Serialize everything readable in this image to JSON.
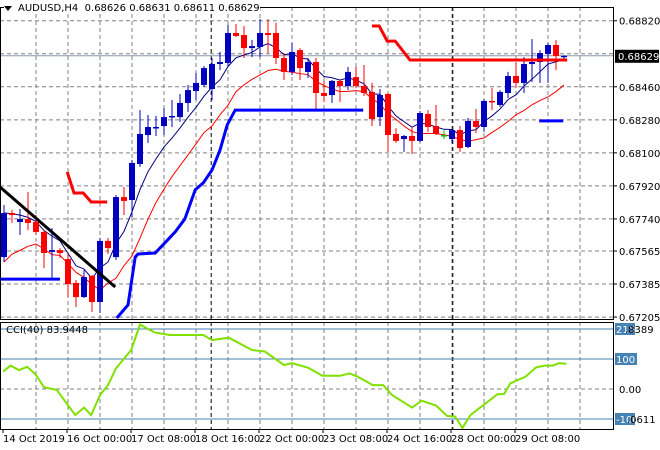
{
  "header": {
    "symbol": "AUDUSD,H4",
    "open": "0.68626",
    "high": "0.68631",
    "low": "0.68611",
    "close": "0.68629"
  },
  "cci_label": {
    "name": "CCI(40)",
    "value": "83.9448"
  },
  "colors": {
    "bull": "#0000c0",
    "bear": "#ff0000",
    "doji": "#00c000",
    "ma_fast": "#000080",
    "ma_slow": "#ff0000",
    "stop_blue": "#0000ff",
    "stop_red": "#ff0000",
    "trend": "#000000",
    "cci": "#80e000",
    "level": "#4682b4",
    "grid": "#808080"
  },
  "chart_data": [
    {
      "type": "candlestick",
      "title": "AUDUSD,H4",
      "ylim": [
        0.67205,
        0.6884
      ],
      "y_ticks": [
        "0.68820",
        "0.68460",
        "0.68280",
        "0.68100",
        "0.67920",
        "0.67740",
        "0.67565",
        "0.67385",
        "0.67205"
      ],
      "current_price": "0.68629",
      "x_labels": [
        {
          "index": 0,
          "label": "14 Oct 2019"
        },
        {
          "index": 8,
          "label": "16 Oct 00:00"
        },
        {
          "index": 16,
          "label": "17 Oct 08:00"
        },
        {
          "index": 24,
          "label": "18 Oct 16:00"
        },
        {
          "index": 32,
          "label": "22 Oct 00:00"
        },
        {
          "index": 40,
          "label": "23 Oct 08:00"
        },
        {
          "index": 48,
          "label": "24 Oct 16:00"
        },
        {
          "index": 56,
          "label": "28 Oct 00:00"
        },
        {
          "index": 64,
          "label": "29 Oct 08:00"
        }
      ],
      "period_separators": [
        25.9,
        56.1
      ],
      "ohlc": [
        [
          0.67532,
          0.67816,
          0.67505,
          0.67772
        ],
        [
          0.67772,
          0.67788,
          0.67718,
          0.67761
        ],
        [
          0.67723,
          0.67794,
          0.67652,
          0.67739
        ],
        [
          0.67739,
          0.67887,
          0.67679,
          0.67718
        ],
        [
          0.67723,
          0.67761,
          0.67652,
          0.67669
        ],
        [
          0.67669,
          0.67679,
          0.67472,
          0.67554
        ],
        [
          0.6756,
          0.6769,
          0.67418,
          0.6757
        ],
        [
          0.6757,
          0.67581,
          0.67527,
          0.67554
        ],
        [
          0.67521,
          0.67549,
          0.67314,
          0.67385
        ],
        [
          0.67391,
          0.67407,
          0.6726,
          0.67314
        ],
        [
          0.67314,
          0.67461,
          0.67309,
          0.67423
        ],
        [
          0.67429,
          0.67434,
          0.67233,
          0.67287
        ],
        [
          0.67287,
          0.67636,
          0.67227,
          0.6762
        ],
        [
          0.6762,
          0.67636,
          0.67549,
          0.67581
        ],
        [
          0.67532,
          0.6787,
          0.67516,
          0.67859
        ],
        [
          0.67859,
          0.67914,
          0.67761,
          0.67838
        ],
        [
          0.67843,
          0.68061,
          0.6775,
          0.68045
        ],
        [
          0.68039,
          0.68333,
          0.68023,
          0.68203
        ],
        [
          0.68197,
          0.68306,
          0.68154,
          0.68241
        ],
        [
          0.68235,
          0.68301,
          0.68192,
          0.68241
        ],
        [
          0.68246,
          0.68344,
          0.68197,
          0.68295
        ],
        [
          0.68295,
          0.68388,
          0.68241,
          0.68301
        ],
        [
          0.68295,
          0.68421,
          0.68268,
          0.68372
        ],
        [
          0.68372,
          0.6847,
          0.68323,
          0.68442
        ],
        [
          0.68437,
          0.68535,
          0.68388,
          0.68481
        ],
        [
          0.6847,
          0.68573,
          0.68459,
          0.68562
        ],
        [
          0.68448,
          0.68617,
          0.68388,
          0.68584
        ],
        [
          0.68584,
          0.6865,
          0.68551,
          0.68595
        ],
        [
          0.6859,
          0.68797,
          0.68568,
          0.68753
        ],
        [
          0.68753,
          0.68802,
          0.68731,
          0.68737
        ],
        [
          0.68742,
          0.68791,
          0.68617,
          0.68671
        ],
        [
          0.68671,
          0.68715,
          0.68622,
          0.68682
        ],
        [
          0.68677,
          0.68829,
          0.68622,
          0.68753
        ],
        [
          0.68753,
          0.68829,
          0.68644,
          0.68742
        ],
        [
          0.68753,
          0.68808,
          0.68584,
          0.68617
        ],
        [
          0.68617,
          0.68644,
          0.68497,
          0.68541
        ],
        [
          0.68541,
          0.68699,
          0.68524,
          0.6865
        ],
        [
          0.6866,
          0.68671,
          0.68497,
          0.68562
        ],
        [
          0.68541,
          0.68617,
          0.68508,
          0.68595
        ],
        [
          0.68595,
          0.68617,
          0.68339,
          0.68426
        ],
        [
          0.68426,
          0.68492,
          0.68377,
          0.6841
        ],
        [
          0.68415,
          0.68497,
          0.68372,
          0.68492
        ],
        [
          0.68492,
          0.68502,
          0.68377,
          0.68464
        ],
        [
          0.68464,
          0.68568,
          0.68442,
          0.68541
        ],
        [
          0.68513,
          0.68568,
          0.68453,
          0.68464
        ],
        [
          0.68464,
          0.68579,
          0.6841,
          0.68426
        ],
        [
          0.68432,
          0.68481,
          0.68246,
          0.68284
        ],
        [
          0.68295,
          0.68448,
          0.68246,
          0.68415
        ],
        [
          0.68421,
          0.68426,
          0.68105,
          0.68197
        ],
        [
          0.68203,
          0.68235,
          0.68154,
          0.68165
        ],
        [
          0.68175,
          0.68197,
          0.68105,
          0.68192
        ],
        [
          0.68192,
          0.68241,
          0.68094,
          0.68165
        ],
        [
          0.68165,
          0.68328,
          0.68159,
          0.68317
        ],
        [
          0.68312,
          0.68333,
          0.68214,
          0.68241
        ],
        [
          0.68246,
          0.68361,
          0.68197,
          0.68203
        ],
        [
          0.68197,
          0.68224,
          0.68175,
          0.68197
        ],
        [
          0.68175,
          0.6823,
          0.68154,
          0.68224
        ],
        [
          0.68224,
          0.68246,
          0.68105,
          0.68126
        ],
        [
          0.68132,
          0.6829,
          0.68126,
          0.68274
        ],
        [
          0.68274,
          0.68339,
          0.68208,
          0.68241
        ],
        [
          0.68241,
          0.68393,
          0.68214,
          0.68383
        ],
        [
          0.68383,
          0.68453,
          0.68333,
          0.68377
        ],
        [
          0.68361,
          0.68442,
          0.6835,
          0.68432
        ],
        [
          0.68426,
          0.68541,
          0.68399,
          0.68519
        ],
        [
          0.68519,
          0.68595,
          0.68453,
          0.68481
        ],
        [
          0.68481,
          0.68622,
          0.68426,
          0.68584
        ],
        [
          0.68584,
          0.6872,
          0.68486,
          0.68595
        ],
        [
          0.68595,
          0.6866,
          0.68481,
          0.68644
        ],
        [
          0.68639,
          0.68699,
          0.68481,
          0.68688
        ],
        [
          0.68688,
          0.68715,
          0.68551,
          0.68628
        ],
        [
          0.68626,
          0.68631,
          0.68611,
          0.68629
        ]
      ],
      "overlays": {
        "stop_blue": [
          [
            [
              -0.5,
              0.67412
            ],
            [
              7,
              0.67412
            ]
          ],
          [
            [
              14.1,
              0.672
            ],
            [
              15.5,
              0.67271
            ],
            [
              16.4,
              0.67532
            ],
            [
              16.75,
              0.67549
            ],
            [
              18.9,
              0.67554
            ],
            [
              20.1,
              0.67609
            ],
            [
              21.4,
              0.67669
            ],
            [
              22.6,
              0.67739
            ],
            [
              23,
              0.67788
            ],
            [
              23.9,
              0.67898
            ],
            [
              24.9,
              0.67936
            ],
            [
              26,
              0.68006
            ],
            [
              27,
              0.68115
            ],
            [
              27.9,
              0.68252
            ],
            [
              28.9,
              0.68333
            ],
            [
              44.9,
              0.68333
            ]
          ],
          [
            [
              66.9,
              0.68274
            ],
            [
              69.9,
              0.68274
            ]
          ]
        ],
        "stop_red": [
          [
            [
              7.9,
              0.67996
            ],
            [
              8.75,
              0.67881
            ],
            [
              9.9,
              0.67881
            ],
            [
              10.9,
              0.67832
            ],
            [
              12.9,
              0.67832
            ]
          ],
          [
            [
              46,
              0.68791
            ],
            [
              46.9,
              0.68791
            ],
            [
              47.9,
              0.68709
            ],
            [
              48.9,
              0.68709
            ],
            [
              50.75,
              0.68606
            ],
            [
              70.4,
              0.68606
            ]
          ]
        ],
        "trendline": [
          [
            -0.5,
            0.67914
          ],
          [
            13.9,
            0.67369
          ]
        ]
      }
    },
    {
      "type": "line",
      "title": "CCI(40)",
      "ylim": [
        -131.0611,
        215.8389
      ],
      "levels": [
        "200",
        "100",
        "-100"
      ],
      "y_ticks": [
        "215.8389",
        "100",
        "0.00",
        "-131.0611"
      ],
      "level_labels": [
        "215",
        "100",
        "-100"
      ],
      "x": [
        -0.1,
        0.8,
        1.9,
        2.9,
        4,
        5,
        6.6,
        8.9,
        10,
        10.9,
        12,
        13,
        14,
        15.9,
        17,
        18,
        18.9,
        20.7,
        24.9,
        26,
        28.1,
        31,
        32.6,
        35,
        36,
        38,
        39.8,
        42,
        43.2,
        44.2,
        46.1,
        47.4,
        48.5,
        51,
        52.2,
        54,
        55.4,
        56.4,
        57.3,
        58.3,
        60.4,
        61.7,
        62.5,
        63.3,
        65.2,
        66.5,
        67.6,
        68.6,
        69.4,
        70.3
      ],
      "values": [
        58,
        78,
        63,
        74,
        47,
        6,
        -3,
        -87,
        -62,
        -87,
        -20,
        13,
        69,
        130,
        215,
        200,
        188,
        180,
        180,
        163,
        171,
        130,
        125,
        80,
        86,
        71,
        44,
        44,
        52,
        41,
        13,
        13,
        -20,
        -62,
        -39,
        -55,
        -90,
        -92,
        -131,
        -87,
        -44,
        -17,
        -17,
        19,
        41,
        72,
        78,
        78,
        86,
        84
      ]
    }
  ]
}
